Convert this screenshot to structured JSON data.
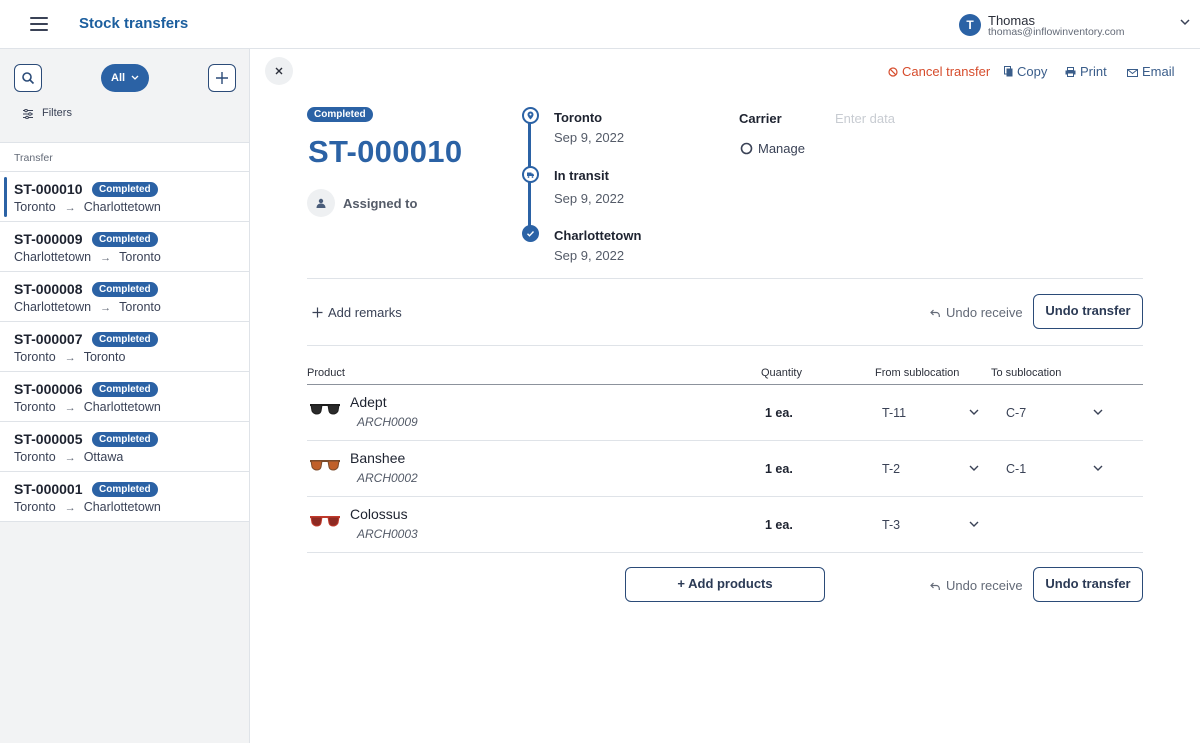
{
  "header": {
    "title": "Stock transfers",
    "user": {
      "initial": "T",
      "name": "Thomas",
      "email": "thomas@inflowinventory.com"
    }
  },
  "sidebar": {
    "filter_pill": "All",
    "filters_label": "Filters",
    "list_header": "Transfer",
    "items": [
      {
        "id": "ST-000010",
        "status": "Completed",
        "from": "Toronto",
        "to": "Charlottetown"
      },
      {
        "id": "ST-000009",
        "status": "Completed",
        "from": "Charlottetown",
        "to": "Toronto"
      },
      {
        "id": "ST-000008",
        "status": "Completed",
        "from": "Charlottetown",
        "to": "Toronto"
      },
      {
        "id": "ST-000007",
        "status": "Completed",
        "from": "Toronto",
        "to": "Toronto"
      },
      {
        "id": "ST-000006",
        "status": "Completed",
        "from": "Toronto",
        "to": "Charlottetown"
      },
      {
        "id": "ST-000005",
        "status": "Completed",
        "from": "Toronto",
        "to": "Ottawa"
      },
      {
        "id": "ST-000001",
        "status": "Completed",
        "from": "Toronto",
        "to": "Charlottetown"
      }
    ]
  },
  "actions": {
    "cancel": "Cancel transfer",
    "copy": "Copy",
    "print": "Print",
    "email": "Email"
  },
  "detail": {
    "status": "Completed",
    "number": "ST-000010",
    "assigned_label": "Assigned to",
    "timeline": [
      {
        "title": "Toronto",
        "date": "Sep 9, 2022"
      },
      {
        "title": "In transit",
        "date": "Sep 9, 2022"
      },
      {
        "title": "Charlottetown",
        "date": "Sep 9, 2022"
      }
    ],
    "carrier_label": "Carrier",
    "carrier_placeholder": "Enter data",
    "manage_label": "Manage",
    "add_remarks": "Add remarks",
    "undo_receive": "Undo receive",
    "undo_transfer": "Undo transfer",
    "add_products": "+ Add products"
  },
  "table": {
    "columns": {
      "product": "Product",
      "quantity": "Quantity",
      "from": "From sublocation",
      "to": "To sublocation"
    },
    "rows": [
      {
        "name": "Adept",
        "sku": "ARCH0009",
        "qty": "1 ea.",
        "from": "T-11",
        "to": "C-7",
        "frame_color": "#1d1d1d",
        "lens_color": "#2a2a2a"
      },
      {
        "name": "Banshee",
        "sku": "ARCH0002",
        "qty": "1 ea.",
        "from": "T-2",
        "to": "C-1",
        "frame_color": "#7a4a2a",
        "lens_color": "#c0602a"
      },
      {
        "name": "Colossus",
        "sku": "ARCH0003",
        "qty": "1 ea.",
        "from": "T-3",
        "to": "",
        "frame_color": "#c0392b",
        "lens_color": "#8e2a22"
      }
    ]
  },
  "colors": {
    "accent": "#2b62a5",
    "danger": "#d64c2c"
  }
}
